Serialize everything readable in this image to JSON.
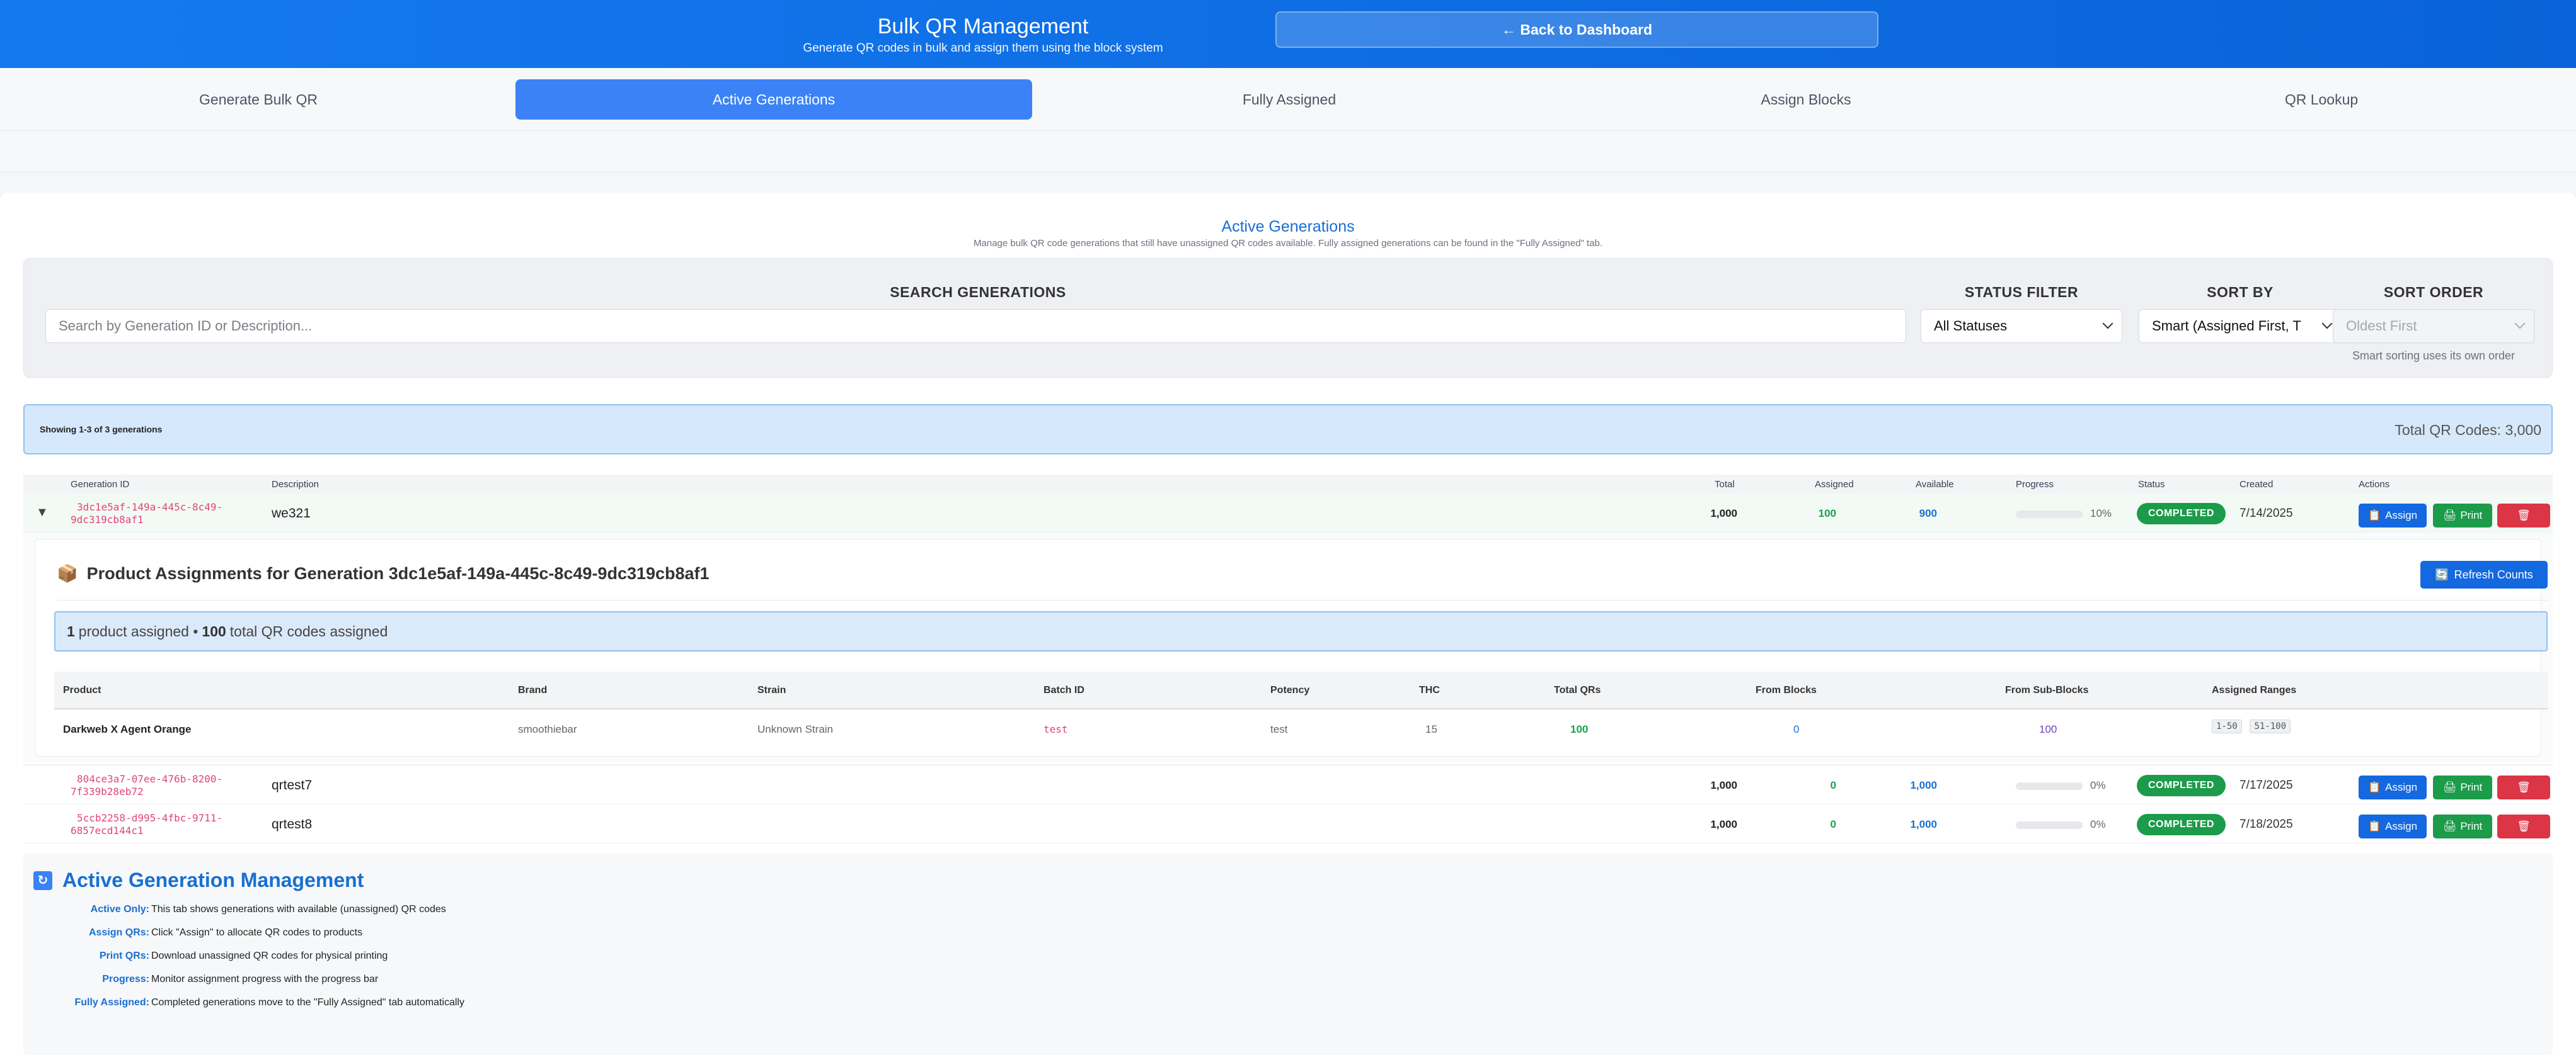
{
  "header": {
    "title": "Bulk QR Management",
    "subtitle": "Generate QR codes in bulk and assign them using the block system",
    "back_label": "← Back to Dashboard"
  },
  "tabs": [
    {
      "label": "Generate Bulk QR",
      "active": false
    },
    {
      "label": "Active Generations",
      "active": true
    },
    {
      "label": "Fully Assigned",
      "active": false
    },
    {
      "label": "Assign Blocks",
      "active": false
    },
    {
      "label": "QR Lookup",
      "active": false
    }
  ],
  "section": {
    "title": "Active Generations",
    "subtitle": "Manage bulk QR code generations that still have unassigned QR codes available. Fully assigned generations can be found in the \"Fully Assigned\" tab."
  },
  "filters": {
    "search_label": "SEARCH GENERATIONS",
    "search_placeholder": "Search by Generation ID or Description...",
    "status_label": "STATUS FILTER",
    "status_value": "All Statuses",
    "sort_by_label": "SORT BY",
    "sort_by_value": "Smart (Assigned First, T",
    "sort_order_label": "SORT ORDER",
    "sort_order_value": "Oldest First",
    "sort_order_hint": "Smart sorting uses its own order"
  },
  "summary": {
    "showing": "Showing 1-3 of 3 generations",
    "total": "Total QR Codes: 3,000"
  },
  "table": {
    "headers": {
      "generation_id": "Generation ID",
      "description": "Description",
      "total": "Total",
      "assigned": "Assigned",
      "available": "Available",
      "progress": "Progress",
      "status": "Status",
      "created": "Created",
      "actions": "Actions"
    },
    "rows": [
      {
        "caret": "▼",
        "generation_id": "3dc1e5af-149a-445c-8c49-9dc319cb8af1",
        "description": "we321",
        "total": "1,000",
        "assigned": "100",
        "available": "900",
        "progress": 0.1,
        "progress_label": "10%",
        "status": "COMPLETED",
        "created": "7/14/2025"
      },
      {
        "caret": "",
        "generation_id": "804ce3a7-07ee-476b-8200-7f339b28eb72",
        "description": "qrtest7",
        "total": "1,000",
        "assigned": "0",
        "available": "1,000",
        "progress": 0,
        "progress_label": "0%",
        "status": "COMPLETED",
        "created": "7/17/2025"
      },
      {
        "caret": "",
        "generation_id": "5ccb2258-d995-4fbc-9711-6857ecd144c1",
        "description": "qrtest8",
        "total": "1,000",
        "assigned": "0",
        "available": "1,000",
        "progress": 0,
        "progress_label": "0%",
        "status": "COMPLETED",
        "created": "7/18/2025"
      }
    ],
    "actions": {
      "assign_label": "Assign",
      "print_label": "Print"
    }
  },
  "expanded": {
    "title_icon": "📦",
    "title": "Product Assignments for Generation 3dc1e5af-149a-445c-8c49-9dc319cb8af1",
    "refresh_label": "Refresh Counts",
    "summary_products": "1",
    "summary_products_text": "product assigned •",
    "summary_qr": "100",
    "summary_qr_text": "total QR codes assigned",
    "headers": {
      "product": "Product",
      "brand": "Brand",
      "strain": "Strain",
      "batch_id": "Batch ID",
      "potency": "Potency",
      "thc": "THC",
      "total_qrs": "Total QRs",
      "from_blocks": "From Blocks",
      "from_sub_blocks": "From Sub-Blocks",
      "assigned_ranges": "Assigned Ranges"
    },
    "row": {
      "product": "Darkweb X Agent Orange",
      "brand": "smoothiebar",
      "strain": "Unknown Strain",
      "batch_id": "test",
      "potency": "test",
      "thc": "15",
      "total_qrs": "100",
      "from_blocks": "0",
      "from_sub_blocks": "100",
      "ranges": [
        "1-50",
        "51-100"
      ]
    }
  },
  "info": {
    "title": "Active Generation Management",
    "items": [
      {
        "key": "Active Only:",
        "value": "This tab shows generations with available (unassigned) QR codes"
      },
      {
        "key": "Assign QRs:",
        "value": "Click \"Assign\" to allocate QR codes to products"
      },
      {
        "key": "Print QRs:",
        "value": "Download unassigned QR codes for physical printing"
      },
      {
        "key": "Progress:",
        "value": "Monitor assignment progress with the progress bar"
      },
      {
        "key": "Fully Assigned:",
        "value": "Completed generations move to the \"Fully Assigned\" tab automatically"
      }
    ]
  },
  "colors": {
    "brand_blue": "#1479f0",
    "active_tab": "#3b82f6",
    "status_green": "#1c9b4a",
    "delete_red": "#dc3545",
    "id_pink": "#e0457b"
  }
}
